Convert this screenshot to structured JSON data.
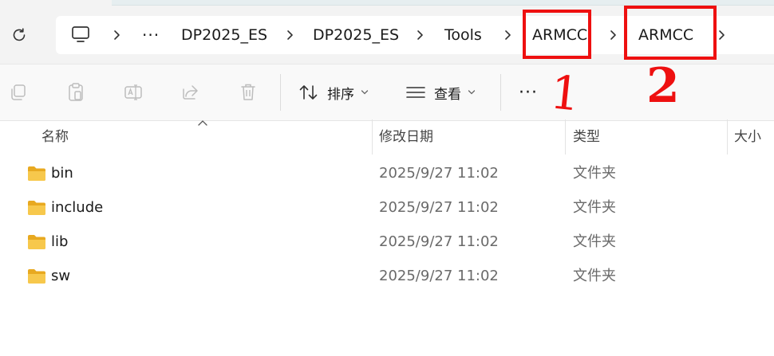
{
  "breadcrumb": {
    "overflow": "···",
    "items": [
      "DP2025_ES",
      "DP2025_ES",
      "Tools",
      "ARMCC",
      "ARMCC"
    ]
  },
  "toolbar": {
    "sort_label": "排序",
    "view_label": "查看",
    "more_label": "···"
  },
  "annotations": {
    "mark_1": "1",
    "mark_2": "2",
    "color": "#ee1010"
  },
  "columns": {
    "name": "名称",
    "date": "修改日期",
    "type": "类型",
    "size": "大小"
  },
  "files": [
    {
      "name": "bin",
      "date": "2025/9/27 11:02",
      "type": "文件夹"
    },
    {
      "name": "include",
      "date": "2025/9/27 11:02",
      "type": "文件夹"
    },
    {
      "name": "lib",
      "date": "2025/9/27 11:02",
      "type": "文件夹"
    },
    {
      "name": "sw",
      "date": "2025/9/27 11:02",
      "type": "文件夹"
    }
  ],
  "colors": {
    "folder": "#f5c04a",
    "annotation_red": "#ee1010"
  }
}
